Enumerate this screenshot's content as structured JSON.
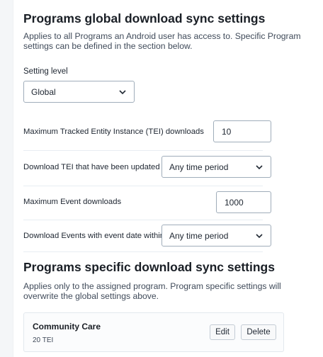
{
  "global_section": {
    "title": "Programs global download sync settings",
    "description": "Applies to all Programs an Android user has access to. Specific Program settings can be defined in the section below.",
    "setting_level_label": "Setting level",
    "setting_level_value": "Global"
  },
  "rows": [
    {
      "label": "Maximum Tracked Entity Instance (TEI) downloads",
      "value": "10"
    },
    {
      "label": "Download TEI that have been updated within",
      "value": "Any time period"
    },
    {
      "label": "Maximum Event downloads",
      "value": "1000"
    },
    {
      "label": "Download Events with event date within",
      "value": "Any time period"
    }
  ],
  "specific_section": {
    "title": "Programs specific download sync settings",
    "description": "Applies only to the assigned program. Program specific settings will overwrite the global settings above."
  },
  "program": {
    "name": "Community Care",
    "meta": "20 TEI",
    "edit_label": "Edit",
    "delete_label": "Delete"
  },
  "colors": {
    "border": "#a0adba",
    "text": "#212934",
    "background": "#f4f6f8"
  },
  "icons": {
    "dropdown": "chevron-down-icon"
  }
}
